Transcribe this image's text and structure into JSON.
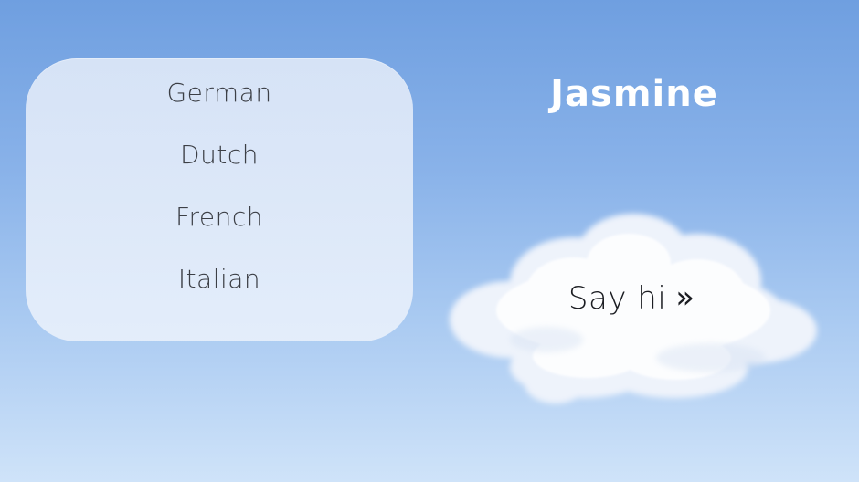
{
  "languages": {
    "items": [
      {
        "label": "German"
      },
      {
        "label": "Dutch"
      },
      {
        "label": "French"
      },
      {
        "label": "Italian"
      }
    ]
  },
  "profile": {
    "name": "Jasmine"
  },
  "cloud_button": {
    "label": "Say hi",
    "icon": "»",
    "icon_name": "double-chevron-right-icon"
  },
  "colors": {
    "sky_top": "#6f9fe0",
    "sky_bottom": "#cfe3f9",
    "panel": "#e2ebf9",
    "text_dark": "#3c3f46",
    "title": "#ffffff"
  }
}
